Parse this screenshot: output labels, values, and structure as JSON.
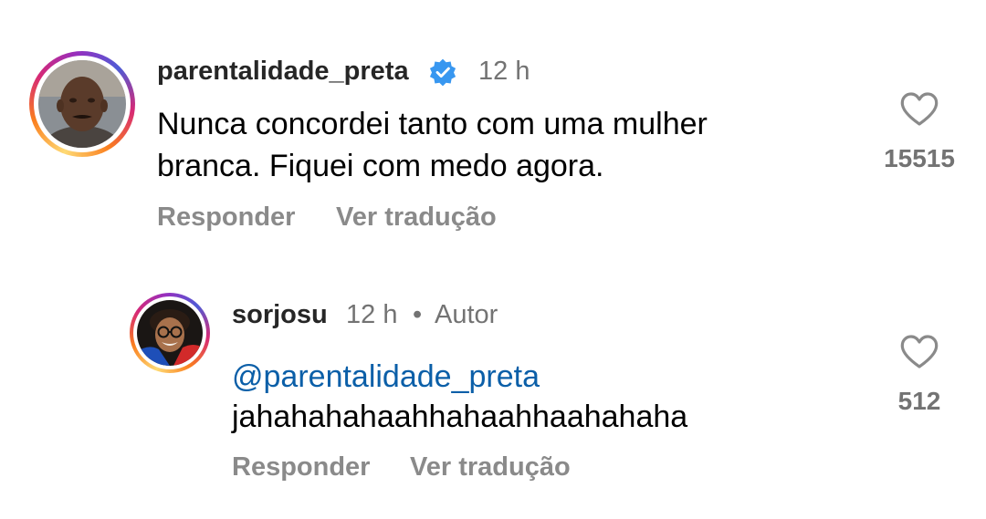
{
  "comments": [
    {
      "username": "parentalidade_preta",
      "verified": true,
      "time": "12 h",
      "text_lines": [
        "Nunca concordei tanto com uma mulher",
        "branca. Fiquei com medo agora."
      ],
      "reply_label": "Responder",
      "translate_label": "Ver tradução",
      "likes": "15515"
    },
    {
      "username": "sorjosu",
      "time": "12 h",
      "separator": "•",
      "author_badge": "Autor",
      "mention": "@parentalidade_preta",
      "text": "jahahahahaahhahaahhaahahaha",
      "reply_label": "Responder",
      "translate_label": "Ver tradução",
      "likes": "512"
    }
  ],
  "colors": {
    "verified_badge": "#3897f0",
    "mention": "#0b5fa8",
    "secondary_text": "#737373"
  }
}
